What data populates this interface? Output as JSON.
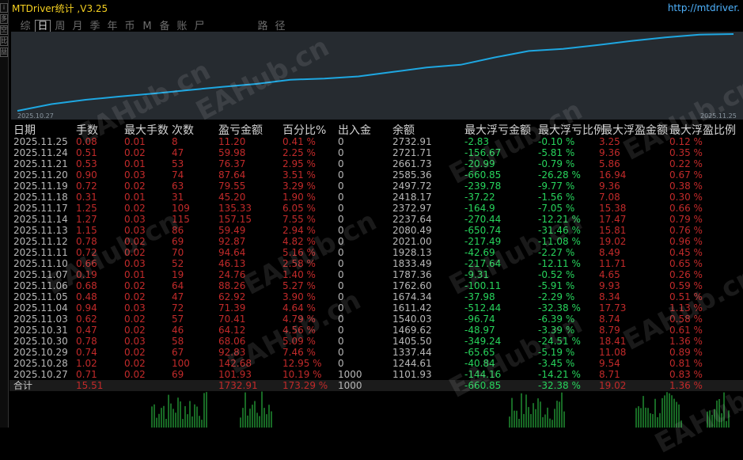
{
  "app": {
    "title": "MTDriver统计 ,V3.25",
    "url": "http://mtdriver.",
    "watermark": "EAHub.cn"
  },
  "tabs": [
    "综",
    "日",
    "周",
    "月",
    "季",
    "年",
    "币",
    "M",
    "备",
    "账",
    "尸",
    "路",
    "径"
  ],
  "active_tab": "日",
  "left_strip": [
    "i",
    "多",
    "空",
    "比",
    "益"
  ],
  "chart_data": {
    "type": "line",
    "x_start_label": "2025.10.27",
    "x_end_label": "2025.11.25",
    "x": [
      "2025.10.27",
      "2025.10.28",
      "2025.10.29",
      "2025.10.30",
      "2025.10.31",
      "2025.11.03",
      "2025.11.04",
      "2025.11.05",
      "2025.11.06",
      "2025.11.07",
      "2025.11.10",
      "2025.11.11",
      "2025.11.12",
      "2025.11.13",
      "2025.11.14",
      "2025.11.17",
      "2025.11.18",
      "2025.11.19",
      "2025.11.20",
      "2025.11.21",
      "2025.11.24",
      "2025.11.25"
    ],
    "y": [
      1101.93,
      1244.61,
      1337.44,
      1405.5,
      1469.62,
      1540.03,
      1611.42,
      1674.34,
      1762.6,
      1787.36,
      1833.49,
      1928.13,
      2021.0,
      2080.49,
      2237.64,
      2372.97,
      2418.17,
      2497.72,
      2585.36,
      2661.73,
      2721.71,
      2732.91
    ],
    "color": "#1ea7e1",
    "background": "#262b30"
  },
  "table": {
    "headers": [
      "日期",
      "手数",
      "最大手数",
      "次数",
      "盈亏金额",
      "百分比%",
      "出入金",
      "余额",
      "最大浮亏金额",
      "最大浮亏比例",
      "最大浮盈金额",
      "最大浮盈比例"
    ],
    "rows": [
      [
        "2025.11.25",
        "0.08",
        "0.01",
        "8",
        "11.20",
        "0.41 %",
        "0",
        "2732.91",
        "-2.83",
        "-0.10 %",
        "3.25",
        "0.12 %"
      ],
      [
        "2025.11.24",
        "0.51",
        "0.02",
        "47",
        "59.98",
        "2.25 %",
        "0",
        "2721.71",
        "-156.67",
        "-5.81 %",
        "9.36",
        "0.35 %"
      ],
      [
        "2025.11.21",
        "0.53",
        "0.01",
        "53",
        "76.37",
        "2.95 %",
        "0",
        "2661.73",
        "-20.99",
        "-0.79 %",
        "5.86",
        "0.22 %"
      ],
      [
        "2025.11.20",
        "0.90",
        "0.03",
        "74",
        "87.64",
        "3.51 %",
        "0",
        "2585.36",
        "-660.85",
        "-26.28 %",
        "16.94",
        "0.67 %"
      ],
      [
        "2025.11.19",
        "0.72",
        "0.02",
        "63",
        "79.55",
        "3.29 %",
        "0",
        "2497.72",
        "-239.78",
        "-9.77 %",
        "9.36",
        "0.38 %"
      ],
      [
        "2025.11.18",
        "0.31",
        "0.01",
        "31",
        "45.20",
        "1.90 %",
        "0",
        "2418.17",
        "-37.22",
        "-1.56 %",
        "7.08",
        "0.30 %"
      ],
      [
        "2025.11.17",
        "1.25",
        "0.02",
        "109",
        "135.33",
        "6.05 %",
        "0",
        "2372.97",
        "-164.9",
        "-7.05 %",
        "15.38",
        "0.66 %"
      ],
      [
        "2025.11.14",
        "1.27",
        "0.03",
        "115",
        "157.15",
        "7.55 %",
        "0",
        "2237.64",
        "-270.44",
        "-12.21 %",
        "17.47",
        "0.79 %"
      ],
      [
        "2025.11.13",
        "1.15",
        "0.03",
        "86",
        "59.49",
        "2.94 %",
        "0",
        "2080.49",
        "-650.74",
        "-31.46 %",
        "15.81",
        "0.76 %"
      ],
      [
        "2025.11.12",
        "0.78",
        "0.02",
        "69",
        "92.87",
        "4.82 %",
        "0",
        "2021.00",
        "-217.49",
        "-11.08 %",
        "19.02",
        "0.96 %"
      ],
      [
        "2025.11.11",
        "0.72",
        "0.02",
        "70",
        "94.64",
        "5.16 %",
        "0",
        "1928.13",
        "-42.69",
        "-2.27 %",
        "8.49",
        "0.45 %"
      ],
      [
        "2025.11.10",
        "0.66",
        "0.03",
        "52",
        "46.13",
        "2.58 %",
        "0",
        "1833.49",
        "-217.64",
        "-12.11 %",
        "11.71",
        "0.65 %"
      ],
      [
        "2025.11.07",
        "0.19",
        "0.01",
        "19",
        "24.76",
        "1.40 %",
        "0",
        "1787.36",
        "-9.31",
        "-0.52 %",
        "4.65",
        "0.26 %"
      ],
      [
        "2025.11.06",
        "0.68",
        "0.02",
        "64",
        "88.26",
        "5.27 %",
        "0",
        "1762.60",
        "-100.11",
        "-5.91 %",
        "9.93",
        "0.59 %"
      ],
      [
        "2025.11.05",
        "0.48",
        "0.02",
        "47",
        "62.92",
        "3.90 %",
        "0",
        "1674.34",
        "-37.98",
        "-2.29 %",
        "8.34",
        "0.51 %"
      ],
      [
        "2025.11.04",
        "0.94",
        "0.03",
        "72",
        "71.39",
        "4.64 %",
        "0",
        "1611.42",
        "-512.44",
        "-32.38 %",
        "17.73",
        "1.13 %"
      ],
      [
        "2025.11.03",
        "0.62",
        "0.02",
        "57",
        "70.41",
        "4.79 %",
        "0",
        "1540.03",
        "-96.74",
        "-6.39 %",
        "8.74",
        "0.58 %"
      ],
      [
        "2025.10.31",
        "0.47",
        "0.02",
        "46",
        "64.12",
        "4.56 %",
        "0",
        "1469.62",
        "-48.97",
        "-3.39 %",
        "8.79",
        "0.61 %"
      ],
      [
        "2025.10.30",
        "0.78",
        "0.03",
        "58",
        "68.06",
        "5.09 %",
        "0",
        "1405.50",
        "-349.24",
        "-24.51 %",
        "18.41",
        "1.36 %"
      ],
      [
        "2025.10.29",
        "0.74",
        "0.02",
        "67",
        "92.83",
        "7.46 %",
        "0",
        "1337.44",
        "-65.65",
        "-5.19 %",
        "11.08",
        "0.89 %"
      ],
      [
        "2025.10.28",
        "1.02",
        "0.02",
        "100",
        "142.68",
        "12.95 %",
        "0",
        "1244.61",
        "-40.84",
        "-3.45 %",
        "9.54",
        "0.81 %"
      ],
      [
        "2025.10.27",
        "0.71",
        "0.02",
        "69",
        "101.93",
        "10.19 %",
        "1000",
        "1101.93",
        "-144.16",
        "-14.21 %",
        "8.71",
        "0.83 %"
      ]
    ],
    "total": [
      "合计",
      "15.51",
      "",
      "",
      "1732.91",
      "173.29 %",
      "1000",
      "",
      "-660.85",
      "-32.38 %",
      "19.02",
      "1.36 %"
    ]
  }
}
